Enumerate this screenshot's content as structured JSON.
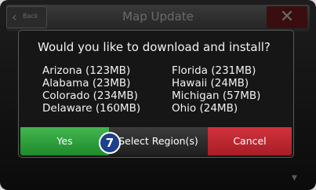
{
  "header": {
    "back_label": "Back",
    "back_icon": "‹",
    "title": "Map Update",
    "close_icon": "✕"
  },
  "dialog": {
    "question": "Would you like to download and install?",
    "left_items": [
      "Arizona (123MB)",
      "Alabama (23MB)",
      "Colorado (234MB)",
      "Delaware (160MB)"
    ],
    "right_items": [
      "Florida (231MB)",
      "Hawaii (24MB)",
      "Michigan (57MB)",
      "Ohio (24MB)"
    ],
    "buttons": {
      "yes": "Yes",
      "select_region": "Select Region(s)",
      "cancel": "Cancel"
    }
  },
  "callout": {
    "number": "7"
  },
  "scroll": {
    "down_icon": "▼"
  },
  "colors": {
    "yes": "#2e9e3a",
    "cancel": "#c3262f",
    "callout": "#1e3f8c"
  }
}
